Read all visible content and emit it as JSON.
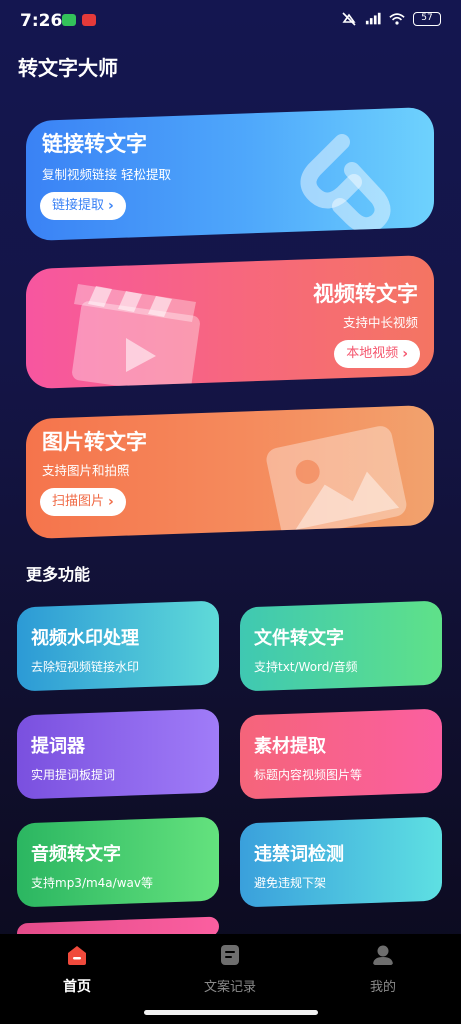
{
  "status_bar": {
    "time": "7:26",
    "battery": "57"
  },
  "app_title": "转文字大师",
  "cards": {
    "link": {
      "title": "链接转文字",
      "subtitle": "复制视频链接 轻松提取",
      "button": "链接提取"
    },
    "video": {
      "title": "视频转文字",
      "subtitle": "支持中长视频",
      "button": "本地视频"
    },
    "image": {
      "title": "图片转文字",
      "subtitle": "支持图片和拍照",
      "button": "扫描图片"
    }
  },
  "section_title": "更多功能",
  "features": [
    {
      "title": "视频水印处理",
      "subtitle": "去除短视频链接水印"
    },
    {
      "title": "文件转文字",
      "subtitle": "支持txt/Word/音频"
    },
    {
      "title": "提词器",
      "subtitle": "实用提词板提词"
    },
    {
      "title": "素材提取",
      "subtitle": "标题内容视频图片等"
    },
    {
      "title": "音频转文字",
      "subtitle": "支持mp3/m4a/wav等"
    },
    {
      "title": "违禁词检测",
      "subtitle": "避免违规下架"
    }
  ],
  "nav": {
    "home": "首页",
    "records": "文案记录",
    "mine": "我的"
  },
  "colors": {
    "accent_red": "#f04a3c",
    "link_button_text": "#3a82f5",
    "video_button_text": "#f5566e",
    "image_button_text": "#f06a45"
  }
}
